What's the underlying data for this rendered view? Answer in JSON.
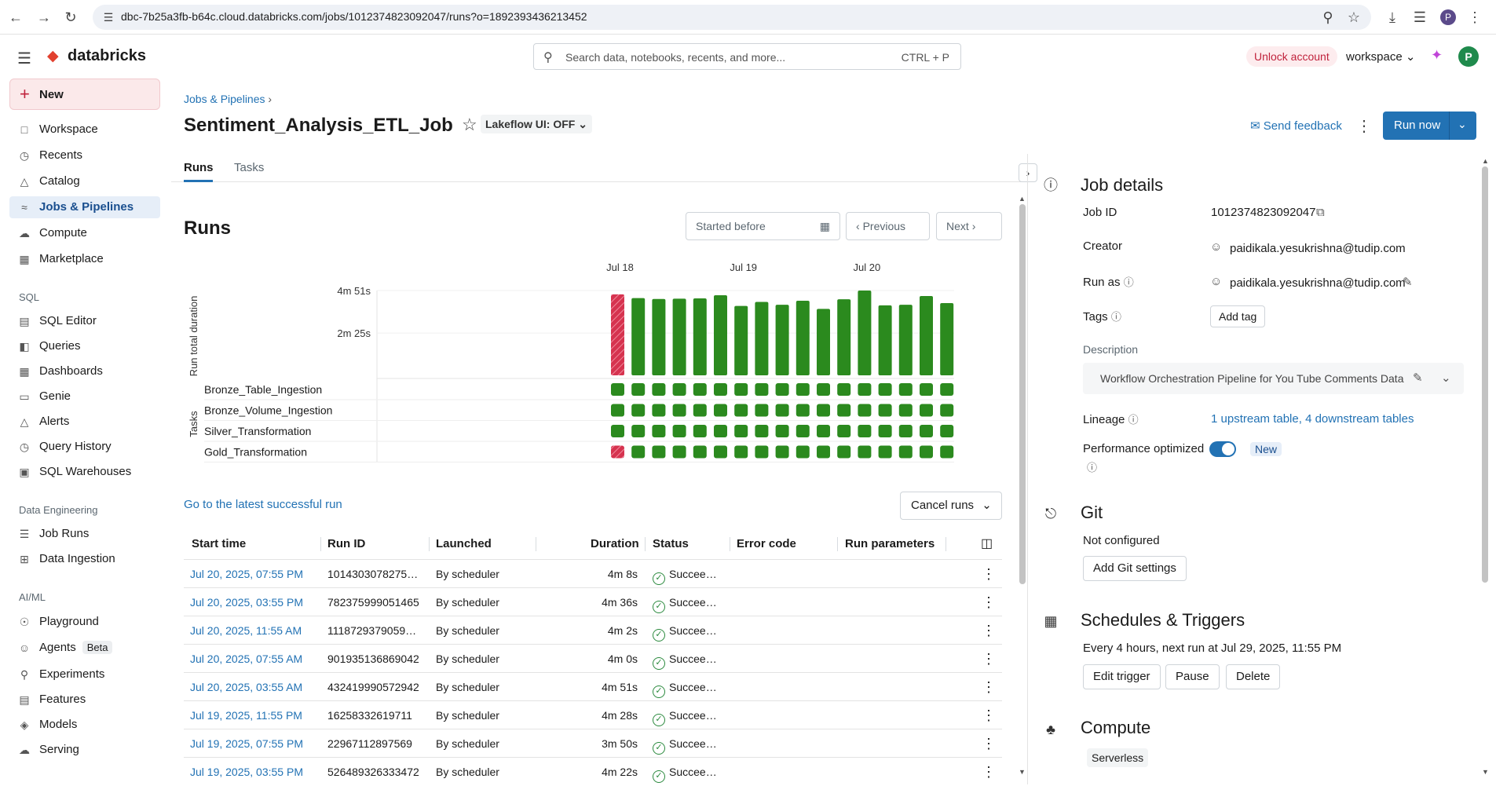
{
  "browser": {
    "url": "dbc-7b25a3fb-b64c.cloud.databricks.com/jobs/1012374823092047/runs?o=1892393436213452",
    "avatar": "P"
  },
  "header": {
    "logo": "databricks",
    "search_placeholder": "Search data, notebooks, recents, and more...",
    "search_shortcut": "CTRL + P",
    "unlock": "Unlock account",
    "workspace": "workspace",
    "avatar": "P"
  },
  "sidebar": {
    "new_label": "New",
    "items": [
      {
        "label": "Workspace",
        "icon": "folder-icon"
      },
      {
        "label": "Recents",
        "icon": "clock-icon"
      },
      {
        "label": "Catalog",
        "icon": "catalog-icon"
      },
      {
        "label": "Jobs & Pipelines",
        "icon": "workflow-icon",
        "active": true
      },
      {
        "label": "Compute",
        "icon": "cloud-icon"
      },
      {
        "label": "Marketplace",
        "icon": "store-icon"
      }
    ],
    "sql_header": "SQL",
    "sql_items": [
      {
        "label": "SQL Editor"
      },
      {
        "label": "Queries"
      },
      {
        "label": "Dashboards"
      },
      {
        "label": "Genie"
      },
      {
        "label": "Alerts"
      },
      {
        "label": "Query History"
      },
      {
        "label": "SQL Warehouses"
      }
    ],
    "de_header": "Data Engineering",
    "de_items": [
      {
        "label": "Job Runs"
      },
      {
        "label": "Data Ingestion"
      }
    ],
    "ml_header": "AI/ML",
    "ml_items": [
      {
        "label": "Playground"
      },
      {
        "label": "Agents",
        "badge": "Beta"
      },
      {
        "label": "Experiments"
      },
      {
        "label": "Features"
      },
      {
        "label": "Models"
      },
      {
        "label": "Serving"
      }
    ]
  },
  "page": {
    "breadcrumb": "Jobs & Pipelines",
    "title": "Sentiment_Analysis_ETL_Job",
    "lakeflow": "Lakeflow UI: OFF",
    "feedback": "Send feedback",
    "run_now": "Run now",
    "tabs": [
      "Runs",
      "Tasks"
    ],
    "runs_heading": "Runs",
    "started_before": "Started before",
    "previous": "Previous",
    "next": "Next",
    "latest_link": "Go to the latest successful run",
    "cancel_runs": "Cancel runs"
  },
  "chart_data": {
    "type": "bar",
    "ylabel": "Run total duration",
    "yticks": [
      "4m 51s",
      "2m 25s"
    ],
    "ytick_seconds": [
      291,
      145
    ],
    "ylim": [
      0,
      291
    ],
    "date_labels": [
      "Jul 18",
      "Jul 19",
      "Jul 20"
    ],
    "date_label_index": [
      0,
      6,
      12
    ],
    "values": [
      278,
      265,
      262,
      263,
      264,
      275,
      238,
      252,
      242,
      256,
      228,
      261,
      291,
      240,
      242,
      272,
      248
    ],
    "status": [
      "failed",
      "success",
      "success",
      "success",
      "success",
      "success",
      "success",
      "success",
      "success",
      "success",
      "success",
      "success",
      "success",
      "success",
      "success",
      "success",
      "success"
    ],
    "tasks_label": "Tasks",
    "tasks": [
      "Bronze_Table_Ingestion",
      "Bronze_Volume_Ingestion",
      "Silver_Transformation",
      "Gold_Transformation"
    ],
    "task_failed_index": [
      null,
      null,
      null,
      0
    ],
    "colors": {
      "success": "#2b8a1e",
      "failed": "#d6334f"
    }
  },
  "table": {
    "columns": [
      "Start time",
      "Run ID",
      "Launched",
      "Duration",
      "Status",
      "Error code",
      "Run parameters"
    ],
    "rows": [
      [
        "Jul 20, 2025, 07:55 PM",
        "1014303078275…",
        "By scheduler",
        "4m 8s",
        "Succee…"
      ],
      [
        "Jul 20, 2025, 03:55 PM",
        "782375999051465",
        "By scheduler",
        "4m 36s",
        "Succee…"
      ],
      [
        "Jul 20, 2025, 11:55 AM",
        "1118729379059…",
        "By scheduler",
        "4m 2s",
        "Succee…"
      ],
      [
        "Jul 20, 2025, 07:55 AM",
        "901935136869042",
        "By scheduler",
        "4m 0s",
        "Succee…"
      ],
      [
        "Jul 20, 2025, 03:55 AM",
        "432419990572942",
        "By scheduler",
        "4m 51s",
        "Succee…"
      ],
      [
        "Jul 19, 2025, 11:55 PM",
        "16258332619711",
        "By scheduler",
        "4m 28s",
        "Succee…"
      ],
      [
        "Jul 19, 2025, 07:55 PM",
        "22967112897569",
        "By scheduler",
        "3m 50s",
        "Succee…"
      ],
      [
        "Jul 19, 2025, 03:55 PM",
        "526489326333472",
        "By scheduler",
        "4m 22s",
        "Succee…"
      ]
    ]
  },
  "details": {
    "heading": "Job details",
    "job_id_label": "Job ID",
    "job_id": "1012374823092047",
    "creator_label": "Creator",
    "creator": "paidikala.yesukrishna@tudip.com",
    "run_as_label": "Run as",
    "run_as": "paidikala.yesukrishna@tudip.com",
    "tags_label": "Tags",
    "add_tag": "Add tag",
    "description_label": "Description",
    "description": "Workflow Orchestration Pipeline for You Tube Comments Data",
    "lineage_label": "Lineage",
    "lineage": "1 upstream table, 4 downstream tables",
    "perf_label": "Performance optimized",
    "perf_new": "New",
    "git_heading": "Git",
    "git_status": "Not configured",
    "git_button": "Add Git settings",
    "sched_heading": "Schedules & Triggers",
    "sched_text": "Every 4 hours, next run at Jul 29, 2025, 11:55 PM",
    "edit_trigger": "Edit trigger",
    "pause": "Pause",
    "delete": "Delete",
    "compute_heading": "Compute",
    "compute_type": "Serverless"
  }
}
